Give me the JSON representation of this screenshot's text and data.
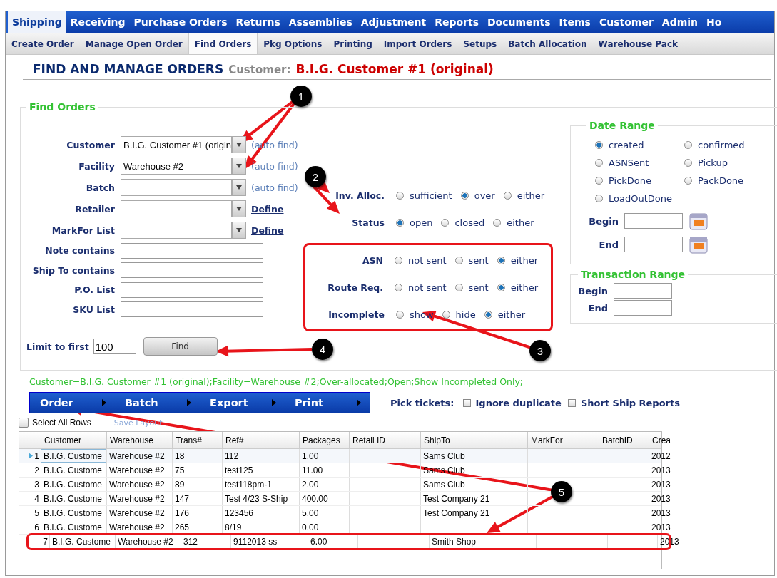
{
  "top_nav": [
    {
      "label": "Shipping",
      "selected": true
    },
    {
      "label": "Receiving",
      "selected": false
    },
    {
      "label": "Purchase Orders",
      "selected": false
    },
    {
      "label": "Returns",
      "selected": false
    },
    {
      "label": "Assemblies",
      "selected": false
    },
    {
      "label": "Adjustment",
      "selected": false
    },
    {
      "label": "Reports",
      "selected": false
    },
    {
      "label": "Documents",
      "selected": false
    },
    {
      "label": "Items",
      "selected": false
    },
    {
      "label": "Customer",
      "selected": false
    },
    {
      "label": "Admin",
      "selected": false
    },
    {
      "label": "Ho",
      "selected": false
    }
  ],
  "sub_nav": [
    {
      "label": "Create Order",
      "selected": false
    },
    {
      "label": "Manage Open Order",
      "selected": false
    },
    {
      "label": "Find Orders",
      "selected": true
    },
    {
      "label": "Pkg Options",
      "selected": false
    },
    {
      "label": "Printing",
      "selected": false
    },
    {
      "label": "Import Orders",
      "selected": false
    },
    {
      "label": "Setups",
      "selected": false
    },
    {
      "label": "Batch Allocation",
      "selected": false
    },
    {
      "label": "Warehouse Pack",
      "selected": false
    }
  ],
  "page_title": {
    "heading": "FIND AND MANAGE ORDERS",
    "customer_label": "Customer:",
    "customer_name": "B.I.G. Customer #1 (original)"
  },
  "find_orders": {
    "legend": "Find Orders",
    "fields": [
      {
        "kind": "select",
        "label": "Customer",
        "value": "B.I.G. Customer #1 (origin",
        "link": "(auto find)",
        "link_emphasized": false
      },
      {
        "kind": "select",
        "label": "Facility",
        "value": "Warehouse #2",
        "link": "(auto find)",
        "link_emphasized": false
      },
      {
        "kind": "select",
        "label": "Batch",
        "link": "(auto find)",
        "link_emphasized": false
      },
      {
        "kind": "select",
        "label": "Retailer",
        "link": "Define",
        "link_emphasized": true
      },
      {
        "kind": "select",
        "label": "MarkFor List",
        "link": "Define",
        "link_emphasized": true
      },
      {
        "kind": "text",
        "label": "Note contains"
      },
      {
        "kind": "text",
        "label": "Ship To contains"
      },
      {
        "kind": "text",
        "label": "P.O. List"
      },
      {
        "kind": "text",
        "label": "SKU List"
      }
    ],
    "filter_groups": [
      {
        "highlighted": false,
        "rows": [
          {
            "label": "Inv. Alloc.",
            "options": [
              {
                "label": "sufficient",
                "selected": false
              },
              {
                "label": "over",
                "selected": true
              },
              {
                "label": "either",
                "selected": false
              }
            ]
          },
          {
            "label": "Status",
            "options": [
              {
                "label": "open",
                "selected": true
              },
              {
                "label": "closed",
                "selected": false
              },
              {
                "label": "either",
                "selected": false
              }
            ]
          }
        ]
      },
      {
        "highlighted": true,
        "rows": [
          {
            "label": "ASN",
            "options": [
              {
                "label": "not sent",
                "selected": false
              },
              {
                "label": "sent",
                "selected": false
              },
              {
                "label": "either",
                "selected": true
              }
            ]
          },
          {
            "label": "Route Req.",
            "options": [
              {
                "label": "not sent",
                "selected": false
              },
              {
                "label": "sent",
                "selected": false
              },
              {
                "label": "either",
                "selected": true
              }
            ]
          },
          {
            "label": "Incomplete",
            "options": [
              {
                "label": "show",
                "selected": false
              },
              {
                "label": "hide",
                "selected": false
              },
              {
                "label": "either",
                "selected": true
              }
            ]
          }
        ]
      }
    ],
    "date_range": {
      "legend": "Date Range",
      "options": [
        {
          "label": "created",
          "selected": true
        },
        {
          "label": "confirmed",
          "selected": false
        },
        {
          "label": "ASNSent",
          "selected": false
        },
        {
          "label": "Pickup",
          "selected": false
        },
        {
          "label": "PickDone",
          "selected": false
        },
        {
          "label": "PackDone",
          "selected": false
        },
        {
          "label": "LoadOutDone",
          "selected": false
        }
      ],
      "begin_label": "Begin",
      "end_label": "End"
    },
    "transaction_range": {
      "legend": "Transaction Range",
      "begin_label": "Begin",
      "end_label": "End"
    },
    "limit": {
      "label": "Limit to first",
      "value": "100"
    },
    "find_button": "Find"
  },
  "summary": "Customer=B.I.G. Customer #1 (original);Facility=Warehouse #2;Over-allocated;Open;Show Incompleted Only;",
  "action_menu": [
    "Order",
    "Batch",
    "Export",
    "Print"
  ],
  "pick_tickets": {
    "label": "Pick tickets:",
    "options": [
      {
        "label": "Ignore duplicate",
        "checked": false
      },
      {
        "label": "Short Ship Reports",
        "checked": false
      }
    ]
  },
  "select_all": {
    "label": "Select All Rows",
    "checked": false
  },
  "save_layout": "Save Layout",
  "grid": {
    "columns": [
      "Customer",
      "Warehouse",
      "Trans#",
      "Ref#",
      "Packages",
      "Retail ID",
      "ShipTo",
      "MarkFor",
      "BatchID",
      "Crea"
    ],
    "rows": [
      {
        "number": "1",
        "selected": true,
        "highlighted": false,
        "cells": [
          "B.I.G. Custome",
          "Warehouse #2",
          "18",
          "112",
          "1.00",
          "",
          "Sams Club",
          "",
          "",
          "2012"
        ]
      },
      {
        "number": "2",
        "selected": false,
        "highlighted": false,
        "cells": [
          "B.I.G. Custome",
          "Warehouse #2",
          "75",
          "test125",
          "11.00",
          "",
          "Sams Club",
          "",
          "",
          "2013"
        ]
      },
      {
        "number": "3",
        "selected": false,
        "highlighted": false,
        "cells": [
          "B.I.G. Custome",
          "Warehouse #2",
          "89",
          "test118pm-1",
          "2.00",
          "",
          "Sams Club",
          "",
          "",
          "2013"
        ]
      },
      {
        "number": "4",
        "selected": false,
        "highlighted": false,
        "cells": [
          "B.I.G. Custome",
          "Warehouse #2",
          "147",
          "Test 4/23 S-Ship",
          "400.00",
          "",
          "Test Company 21",
          "",
          "",
          "2013"
        ]
      },
      {
        "number": "5",
        "selected": false,
        "highlighted": false,
        "cells": [
          "B.I.G. Custome",
          "Warehouse #2",
          "176",
          "123456",
          "5.00",
          "",
          "Test Company 21",
          "",
          "",
          "2013"
        ]
      },
      {
        "number": "6",
        "selected": false,
        "highlighted": false,
        "cells": [
          "B.I.G. Custome",
          "Warehouse #2",
          "265",
          "8/19",
          "0.00",
          "",
          "",
          "",
          "",
          "2013"
        ]
      },
      {
        "number": "7",
        "selected": false,
        "highlighted": true,
        "cells": [
          "B.I.G. Custome",
          "Warehouse #2",
          "312",
          "9112013 ss",
          "6.00",
          "",
          "Smith Shop",
          "",
          "",
          "2013"
        ]
      }
    ]
  },
  "callouts": [
    "1",
    "2",
    "3",
    "4",
    "5"
  ]
}
